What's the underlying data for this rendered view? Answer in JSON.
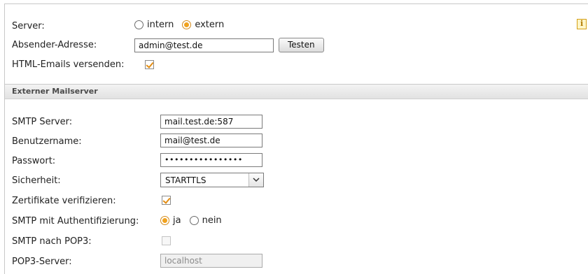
{
  "general": {
    "server_label": "Server:",
    "server_options": [
      {
        "label": "intern",
        "checked": false
      },
      {
        "label": "extern",
        "checked": true
      }
    ],
    "sender_label": "Absender-Adresse:",
    "sender_value": "admin@test.de",
    "test_button": "Testen",
    "html_label": "HTML-Emails versenden:",
    "html_checked": true,
    "info_icon": "info-icon"
  },
  "external": {
    "section_title": "Externer Mailserver",
    "smtp_server_label": "SMTP Server:",
    "smtp_server_value": "mail.test.de:587",
    "username_label": "Benutzername:",
    "username_value": "mail@test.de",
    "password_label": "Passwort:",
    "password_value": "••••••••••••••••",
    "security_label": "Sicherheit:",
    "security_value": "STARTTLS",
    "verify_label": "Zertifikate verifizieren:",
    "verify_checked": true,
    "auth_label": "SMTP mit Authentifizierung:",
    "auth_options": [
      {
        "label": "ja",
        "checked": true
      },
      {
        "label": "nein",
        "checked": false
      }
    ],
    "pop3_label": "SMTP nach POP3:",
    "pop3_checked": false,
    "pop3_server_label": "POP3-Server:",
    "pop3_server_value": "localhost"
  },
  "colors": {
    "accent": "#f0a21f",
    "section_header_bg": "#e8e8e8"
  }
}
